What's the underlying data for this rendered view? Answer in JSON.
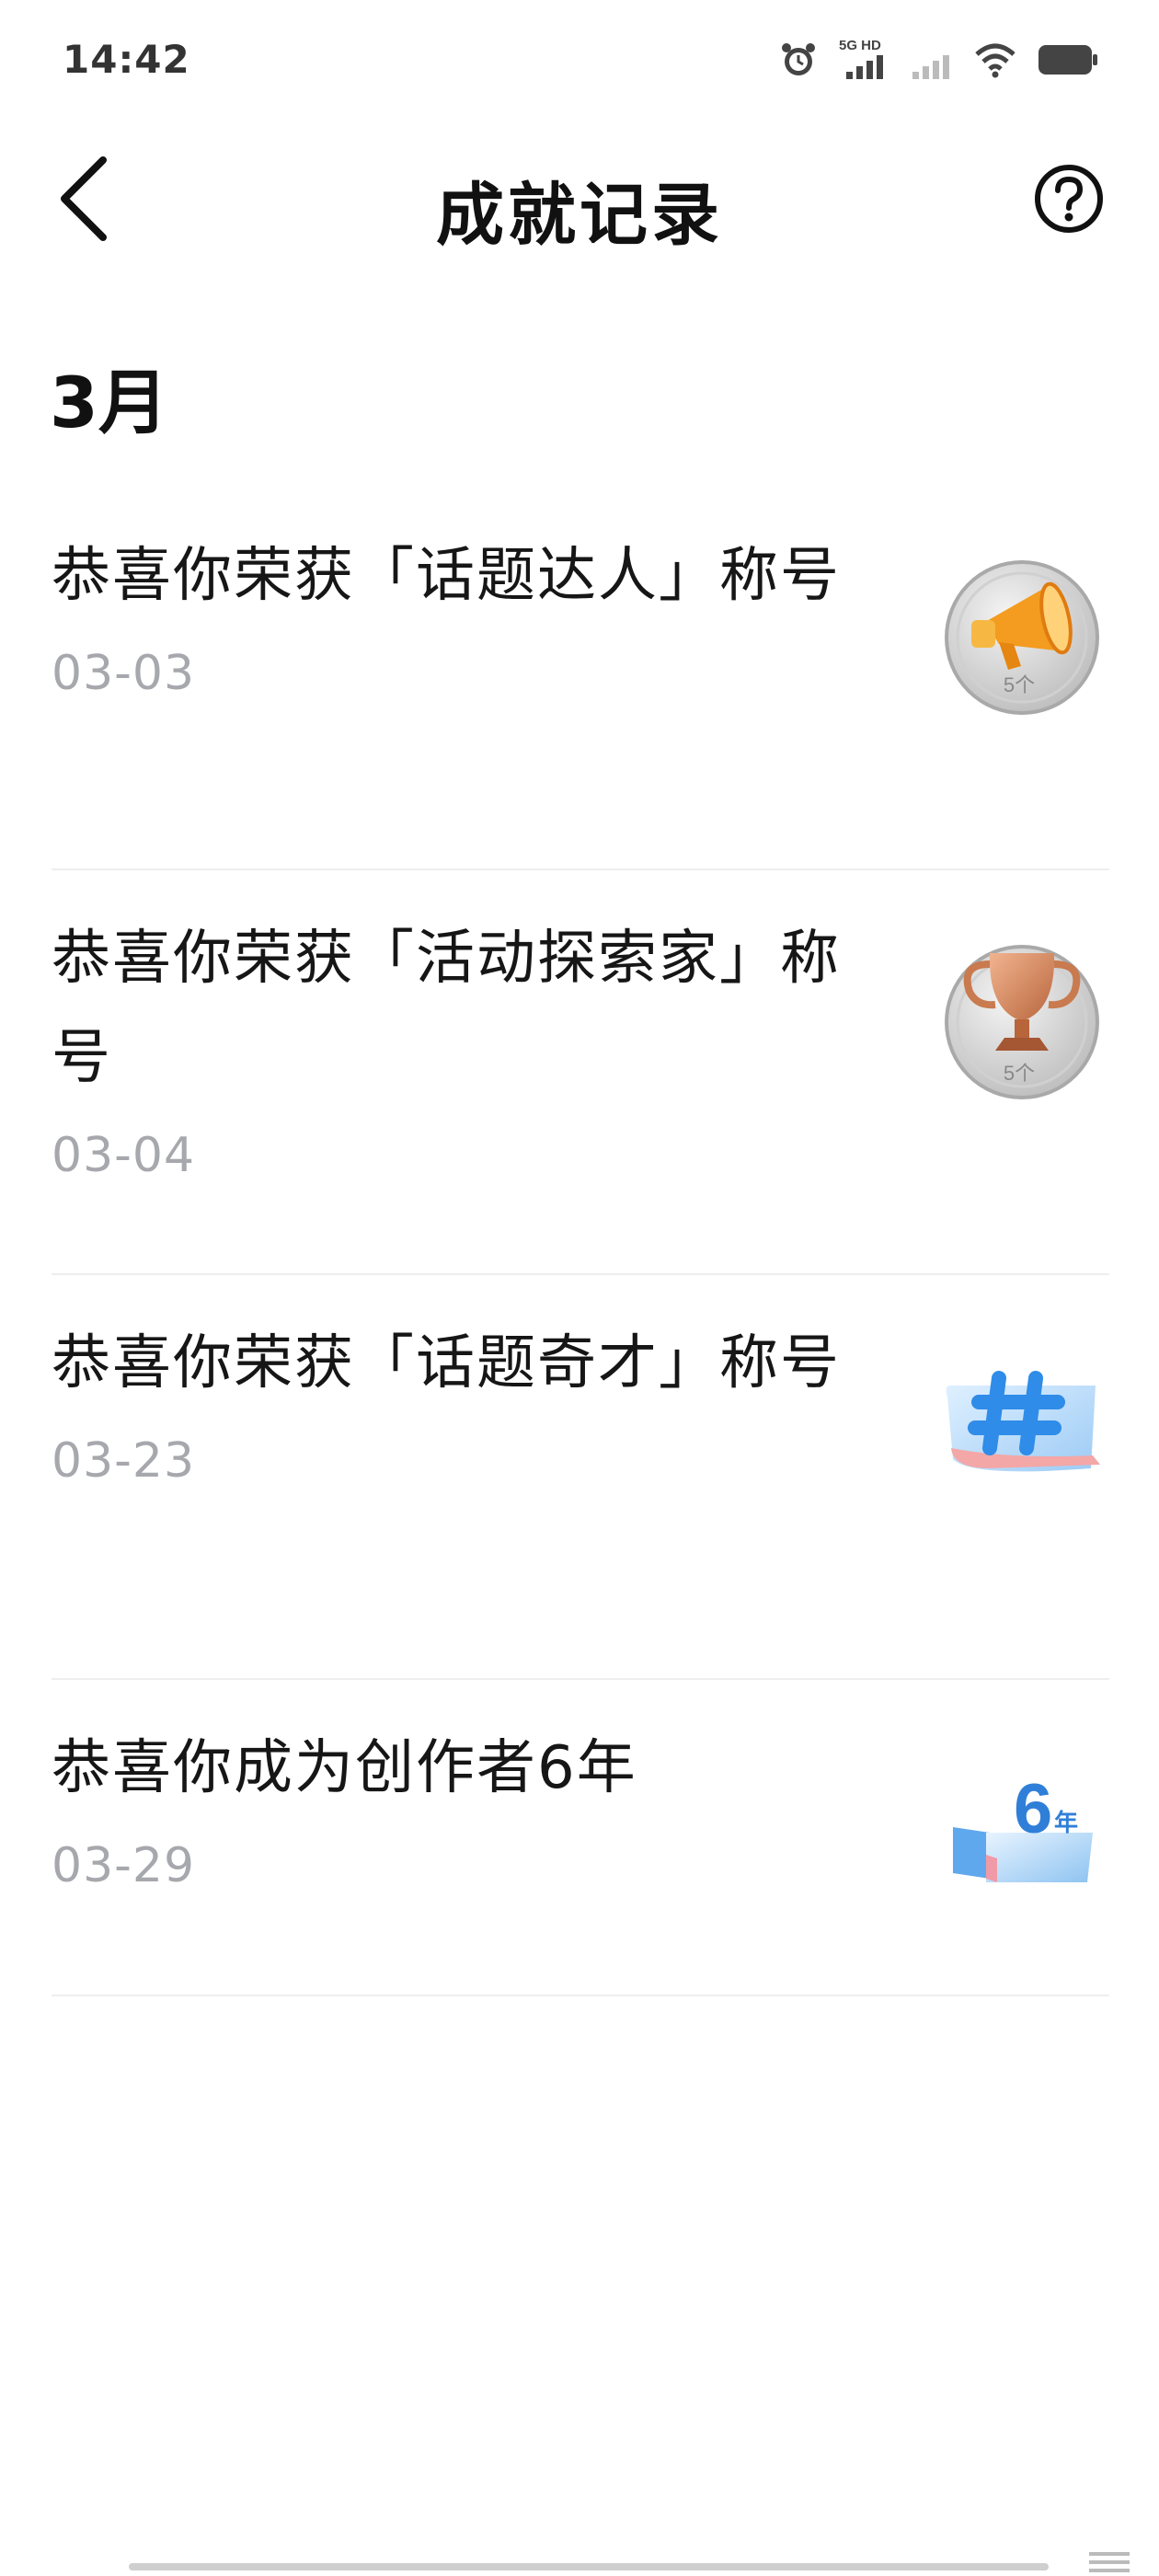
{
  "status_bar": {
    "time": "14:42",
    "network_label": "5G HD",
    "icons": [
      "alarm-icon",
      "cellular-signal-icon",
      "cellular-signal-weak-icon",
      "wifi-icon",
      "battery-icon"
    ]
  },
  "header": {
    "title": "成就记录",
    "back_icon": "chevron-left-icon",
    "help_icon": "question-circle-icon"
  },
  "sections": [
    {
      "month": "3月",
      "items": [
        {
          "title": "恭喜你荣获「话题达人」称号",
          "date": "03-03",
          "badge_icon": "megaphone-badge-icon",
          "badge_count": "5个"
        },
        {
          "title": "恭喜你荣获「活动探索家」称号",
          "date": "03-04",
          "badge_icon": "trophy-badge-icon",
          "badge_count": "5个"
        },
        {
          "title": "恭喜你荣获「话题奇才」称号",
          "date": "03-23",
          "badge_icon": "hashtag-badge-icon"
        },
        {
          "title": "恭喜你成为创作者6年",
          "date": "03-29",
          "badge_icon": "anniversary-badge-icon",
          "badge_text": "6",
          "badge_subtext": "年"
        }
      ]
    }
  ],
  "colors": {
    "title": "#111111",
    "body_text": "#161616",
    "date": "#a6a8ad",
    "divider": "#eeeeee",
    "accent_orange": "#f5a623",
    "accent_blue": "#3d8ef0"
  }
}
